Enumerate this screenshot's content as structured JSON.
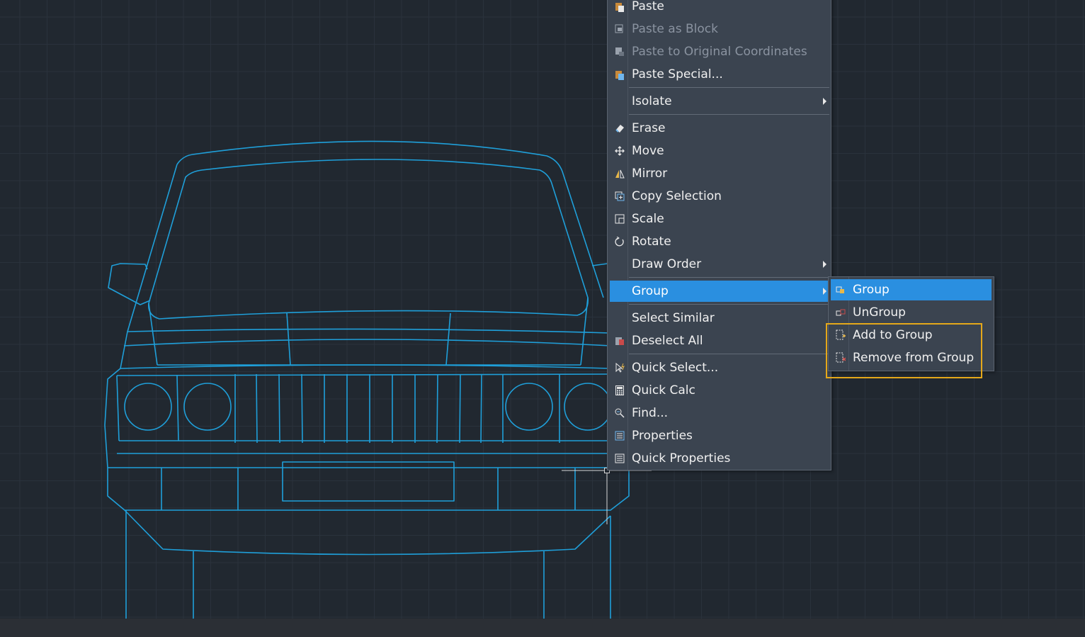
{
  "colors": {
    "canvas_background": "#212830",
    "grid_line": "#2a323c",
    "drawing_stroke": "#1f9fd9",
    "menu_background": "#3b4450",
    "menu_highlight": "#2a8fe0",
    "callout_box": "#e5a81a"
  },
  "context_menu": {
    "items": [
      {
        "label": "Paste",
        "icon": "paste-icon",
        "disabled": false
      },
      {
        "label": "Paste as Block",
        "icon": "paste-as-block-icon",
        "disabled": true
      },
      {
        "label": "Paste to Original Coordinates",
        "icon": "paste-to-original-coordinates-icon",
        "disabled": true
      },
      {
        "label": "Paste Special...",
        "icon": "paste-special-icon",
        "disabled": false
      },
      {
        "label": "Isolate",
        "icon": "",
        "submenu": true
      },
      {
        "label": "Erase",
        "icon": "eraser-icon"
      },
      {
        "label": "Move",
        "icon": "move-icon"
      },
      {
        "label": "Mirror",
        "icon": "mirror-icon"
      },
      {
        "label": "Copy Selection",
        "icon": "copy-icon"
      },
      {
        "label": "Scale",
        "icon": "scale-icon"
      },
      {
        "label": "Rotate",
        "icon": "rotate-icon"
      },
      {
        "label": "Draw Order",
        "icon": "",
        "submenu": true
      },
      {
        "label": "Group",
        "icon": "",
        "submenu": true,
        "highlighted": true
      },
      {
        "label": "Select Similar",
        "icon": ""
      },
      {
        "label": "Deselect All",
        "icon": "deselect-icon"
      },
      {
        "label": "Quick Select...",
        "icon": "quick-select-icon"
      },
      {
        "label": "Quick Calc",
        "icon": "calculator-icon"
      },
      {
        "label": "Find...",
        "icon": "find-icon"
      },
      {
        "label": "Properties",
        "icon": "properties-icon"
      },
      {
        "label": "Quick Properties",
        "icon": "quick-properties-icon"
      }
    ]
  },
  "group_submenu": {
    "items": [
      {
        "label": "Group",
        "icon": "group-icon",
        "highlighted": true
      },
      {
        "label": "UnGroup",
        "icon": "ungroup-icon"
      },
      {
        "label": "Add to Group",
        "icon": "add-to-group-icon"
      },
      {
        "label": "Remove from Group",
        "icon": "remove-from-group-icon"
      }
    ]
  }
}
